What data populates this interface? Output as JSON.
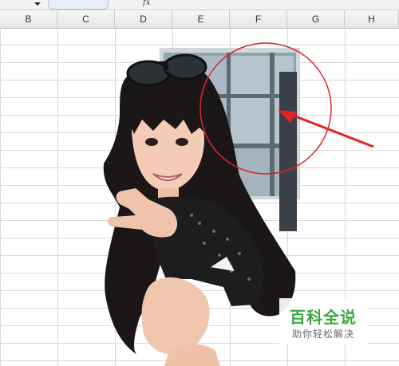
{
  "formula_bar": {
    "fx": "fx"
  },
  "columns": [
    "B",
    "C",
    "D",
    "E",
    "F",
    "G",
    "H"
  ],
  "picture": {
    "description_icon": "photo-object"
  },
  "annotation": {
    "circle_color": "#d9262b",
    "arrow_color": "#e02424"
  },
  "watermark": {
    "title": "百科全说",
    "subtitle": "助你轻松解决"
  }
}
